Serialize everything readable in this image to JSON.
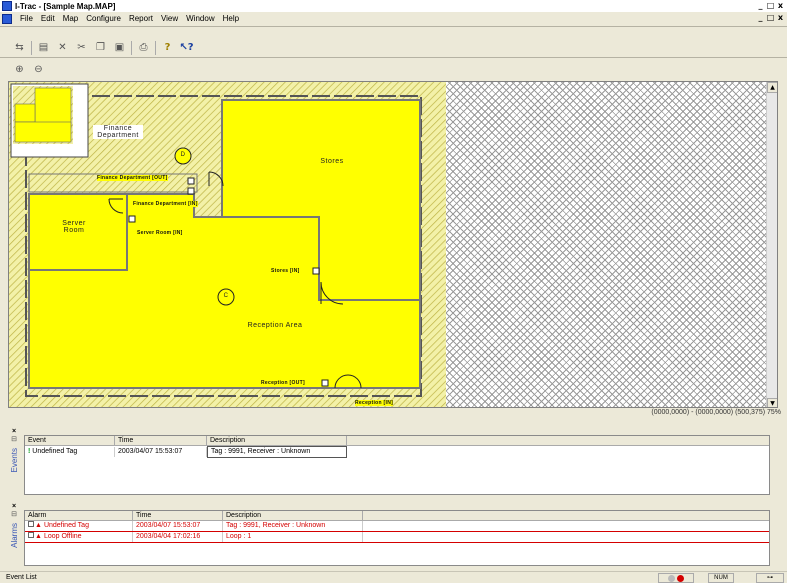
{
  "window": {
    "title": "I-Trac - [Sample Map.MAP]",
    "controls": [
      "_",
      "□",
      "x"
    ],
    "doc_controls": [
      "_",
      "□",
      "x"
    ]
  },
  "menu": [
    "File",
    "Edit",
    "Map",
    "Configure",
    "Report",
    "View",
    "Window",
    "Help"
  ],
  "toolbar_icons": [
    "connect-icon",
    "properties-icon",
    "delete-icon",
    "cut-icon",
    "copy-icon",
    "paste-icon",
    "print-icon",
    "help-icon",
    "context-help-icon"
  ],
  "zoom_icons": [
    "zoom-in-icon",
    "zoom-out-icon"
  ],
  "map": {
    "rooms": {
      "finance": "Finance\nDepartment",
      "stores": "Stores",
      "server": "Server\nRoom",
      "reception": "Reception Area"
    },
    "doors": {
      "finance_out": "Finance Department [OUT]",
      "finance_in": "Finance Department [IN]",
      "server_in": "Server Room [IN]",
      "stores_in": "Stores [IN]",
      "reception_out": "Reception [OUT]",
      "reception_in": "Reception [IN]"
    },
    "receivers": {
      "d": "D",
      "c": "C"
    },
    "colors": {
      "room_fill": "#ffff00",
      "hatch": "#c8c048"
    }
  },
  "coords": "(0000,0000) - (0000,0000)  (500,375) 75%",
  "events": {
    "side_label": "Events",
    "columns": [
      "Event",
      "Time",
      "Description"
    ],
    "rows": [
      {
        "event": "Undefined Tag",
        "time": "2003/04/07 15:53:07",
        "description": "Tag : 9991, Receiver : Unknown"
      }
    ]
  },
  "alarms": {
    "side_label": "Alarms",
    "columns": [
      "Alarm",
      "Time",
      "Description"
    ],
    "rows": [
      {
        "alarm": "Undefined Tag",
        "time": "2003/04/07 15:53:07",
        "description": "Tag : 9991, Receiver : Unknown"
      },
      {
        "alarm": "Loop Offline",
        "time": "2003/04/04 17:02:16",
        "description": "Loop : 1"
      }
    ]
  },
  "status": {
    "text": "Event List",
    "num": "NUM"
  }
}
